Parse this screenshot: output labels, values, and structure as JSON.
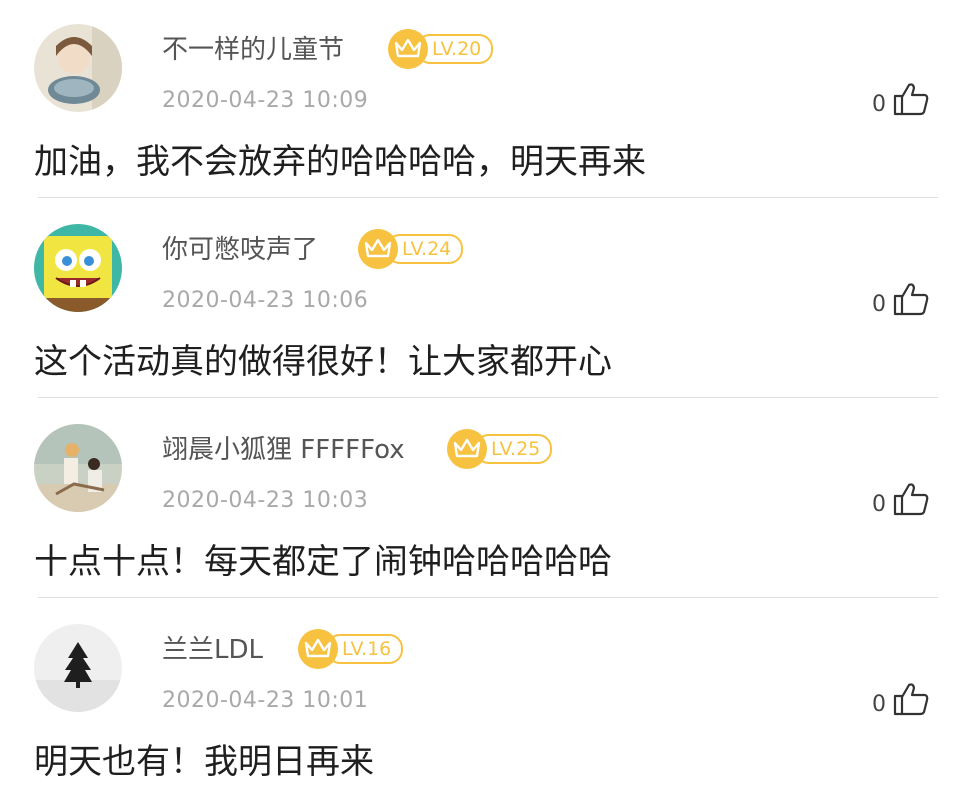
{
  "comments": [
    {
      "username": "不一样的儿童节",
      "level": "LV.20",
      "timestamp": "2020-04-23 10:09",
      "likes": "0",
      "content": "加油，我不会放弃的哈哈哈哈，明天再来"
    },
    {
      "username": "你可憋吱声了",
      "level": "LV.24",
      "timestamp": "2020-04-23 10:06",
      "likes": "0",
      "content": "这个活动真的做得很好！让大家都开心"
    },
    {
      "username": "翊晨小狐狸 FFFFFox",
      "level": "LV.25",
      "timestamp": "2020-04-23 10:03",
      "likes": "0",
      "content": "十点十点！每天都定了闹钟哈哈哈哈哈"
    },
    {
      "username": "兰兰LDL",
      "level": "LV.16",
      "timestamp": "2020-04-23 10:01",
      "likes": "0",
      "content": "明天也有！我明日再来"
    }
  ],
  "colors": {
    "badge": "#f6c23f",
    "username": "#555555",
    "timestamp": "#a9a9a9",
    "content": "#1f1f1f",
    "divider": "#dddddd"
  },
  "icons": {
    "like": "thumbs-up-icon",
    "level": "crown-icon"
  }
}
